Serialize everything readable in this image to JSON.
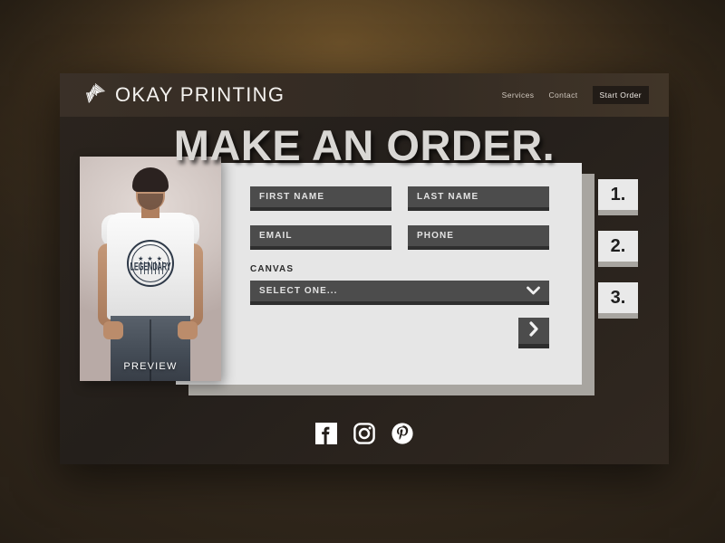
{
  "site": {
    "brand_name": "OKAY PRINTING",
    "logo_icon": "fan-quill-logo-icon",
    "page_title": "MAKE AN ORDER.",
    "nav": [
      {
        "label": "Services",
        "name": "nav-services"
      },
      {
        "label": "Contact",
        "name": "nav-contact"
      }
    ],
    "cta": {
      "label": "Start Order"
    }
  },
  "preview": {
    "label": "PREVIEW",
    "shirt_graphic": {
      "stars": "★ ★ ★",
      "word": "LEGENDARY"
    }
  },
  "form": {
    "fields": [
      {
        "name": "first-name-input",
        "placeholder": "FIRST NAME",
        "value": ""
      },
      {
        "name": "last-name-input",
        "placeholder": "LAST NAME",
        "value": ""
      },
      {
        "name": "email-input",
        "placeholder": "EMAIL",
        "value": ""
      },
      {
        "name": "phone-input",
        "placeholder": "PHONE",
        "value": ""
      }
    ],
    "canvas": {
      "label": "CANVAS",
      "selected": "SELECT ONE...",
      "chevron_icon": "chevron-down-icon"
    },
    "next_button": {
      "icon": "chevron-right-icon"
    }
  },
  "steps": [
    {
      "label": "1."
    },
    {
      "label": "2."
    },
    {
      "label": "3."
    }
  ],
  "social": [
    {
      "name": "facebook-icon",
      "label": "Facebook"
    },
    {
      "name": "instagram-icon",
      "label": "Instagram"
    },
    {
      "name": "pinterest-icon",
      "label": "Pinterest"
    }
  ],
  "colors": {
    "backdrop_gold": "#a97c3a",
    "window_dark": "#2b241e",
    "panel_light": "#e6e6e6",
    "panel_shadow": "#a8a5a0",
    "field_dark": "#4c4c4c",
    "field_underline": "#2e2e2e",
    "title_gray": "#d9d7d4"
  }
}
